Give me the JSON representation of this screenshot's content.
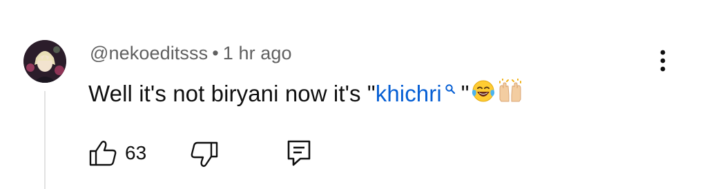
{
  "comment": {
    "username": "@nekoeditsss",
    "separator": "•",
    "timestamp": "1 hr ago",
    "text_before": "Well it's not biryani now it's \"",
    "search_term": "khichri",
    "text_after": "\"",
    "emojis": [
      "face-with-tears-of-joy",
      "raising-hands"
    ]
  },
  "actions": {
    "like_count": "63"
  },
  "icons": {
    "more": "more-vertical-icon",
    "like": "thumbs-up-icon",
    "dislike": "thumbs-down-icon",
    "reply": "reply-comment-icon",
    "search": "search-icon"
  },
  "colors": {
    "link": "#065fd4",
    "meta": "#606060",
    "text": "#0f0f0f"
  }
}
